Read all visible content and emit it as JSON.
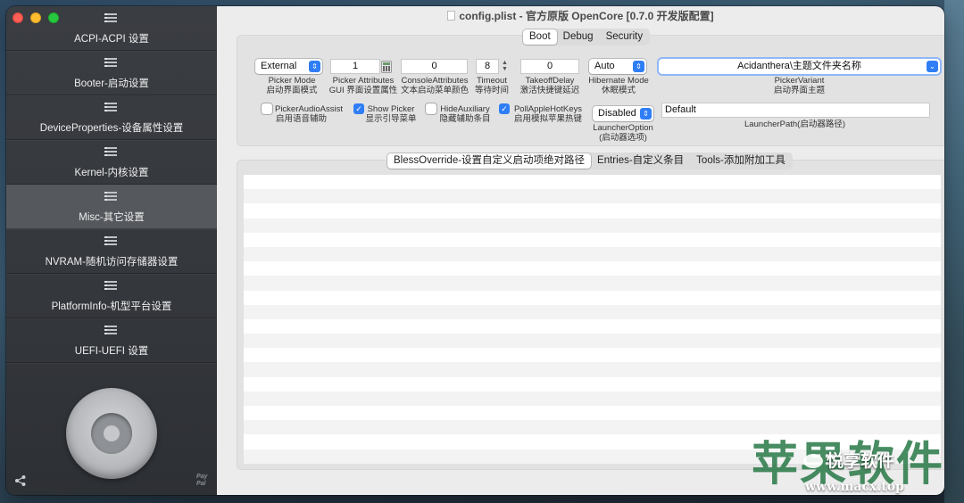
{
  "window": {
    "title": "config.plist - 官方原版 OpenCore [0.7.0 开发版配置]"
  },
  "sidebar": {
    "items": [
      {
        "label": "ACPI-ACPI 设置",
        "active": false
      },
      {
        "label": "Booter-启动设置",
        "active": false
      },
      {
        "label": "DeviceProperties-设备属性设置",
        "active": false
      },
      {
        "label": "Kernel-内核设置",
        "active": false
      },
      {
        "label": "Misc-其它设置",
        "active": true
      },
      {
        "label": "NVRAM-随机访问存储器设置",
        "active": false
      },
      {
        "label": "PlatformInfo-机型平台设置",
        "active": false
      },
      {
        "label": "UEFI-UEFI 设置",
        "active": false
      }
    ],
    "paypal_text": "Pay Pal"
  },
  "top_tabs": [
    {
      "label": "Boot",
      "active": true
    },
    {
      "label": "Debug",
      "active": false
    },
    {
      "label": "Security",
      "active": false
    }
  ],
  "boot": {
    "picker_mode": {
      "value": "External",
      "label1": "Picker Mode",
      "label2": "启动界面模式"
    },
    "picker_attributes": {
      "value": "1",
      "label1": "Picker Attributes",
      "label2": "GUI 界面设置属性"
    },
    "console_attributes": {
      "value": "0",
      "label1": "ConsoleAttributes",
      "label2": "文本启动菜单颜色"
    },
    "timeout": {
      "value": "8",
      "label1": "Timeout",
      "label2": "等待时间"
    },
    "takeoff_delay": {
      "value": "0",
      "label1": "TakeoffDelay",
      "label2": "激活快捷键延迟"
    },
    "hibernate_mode": {
      "value": "Auto",
      "label1": "Hibernate Mode",
      "label2": "休眠模式"
    },
    "picker_variant": {
      "value": "Acidanthera\\主题文件夹名称",
      "label1": "PickerVariant",
      "label2": "启动界面主题"
    },
    "picker_audio_assist": {
      "label1": "PickerAudioAssist",
      "label2": "启用语音辅助",
      "checked": false
    },
    "show_picker": {
      "label1": "Show Picker",
      "label2": "显示引导菜单",
      "checked": true
    },
    "hide_auxiliary": {
      "label1": "HideAuxiliary",
      "label2": "隐藏辅助条目",
      "checked": false
    },
    "poll_apple_hotkeys": {
      "label1": "PollAppleHotKeys",
      "label2": "启用模拟苹果热键",
      "checked": true
    },
    "launcher_option": {
      "value": "Disabled",
      "label1": "LauncherOption",
      "label2": "(启动器选项)"
    },
    "launcher_path": {
      "value": "Default",
      "label": "LauncherPath(启动器路径)"
    }
  },
  "lower_tabs": [
    {
      "label": "BlessOverride-设置自定义启动项绝对路径",
      "active": true
    },
    {
      "label": "Entries-自定义条目",
      "active": false
    },
    {
      "label": "Tools-添加附加工具",
      "active": false
    }
  ],
  "watermark": {
    "big_text": "苹果软件",
    "badge_text": "悦享软件",
    "url": "www.macx.top"
  }
}
